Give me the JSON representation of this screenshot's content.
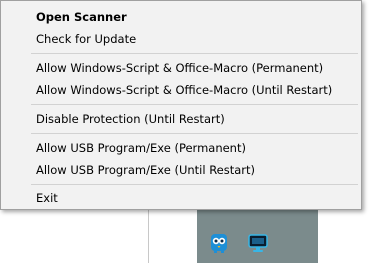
{
  "menu": {
    "items": [
      {
        "label": "Open Scanner",
        "bold": true
      },
      {
        "label": "Check for Update"
      },
      {
        "label": "Allow Windows-Script & Office-Macro (Permanent)"
      },
      {
        "label": "Allow Windows-Script & Office-Macro (Until Restart)"
      },
      {
        "label": "Disable Protection (Until Restart)"
      },
      {
        "label": "Allow USB Program/Exe (Permanent)"
      },
      {
        "label": "Allow USB Program/Exe (Until Restart)"
      },
      {
        "label": "Exit"
      }
    ]
  },
  "tray": {
    "icons": [
      "owl-icon",
      "monitor-icon"
    ],
    "background_color": "#7b8b8c"
  }
}
